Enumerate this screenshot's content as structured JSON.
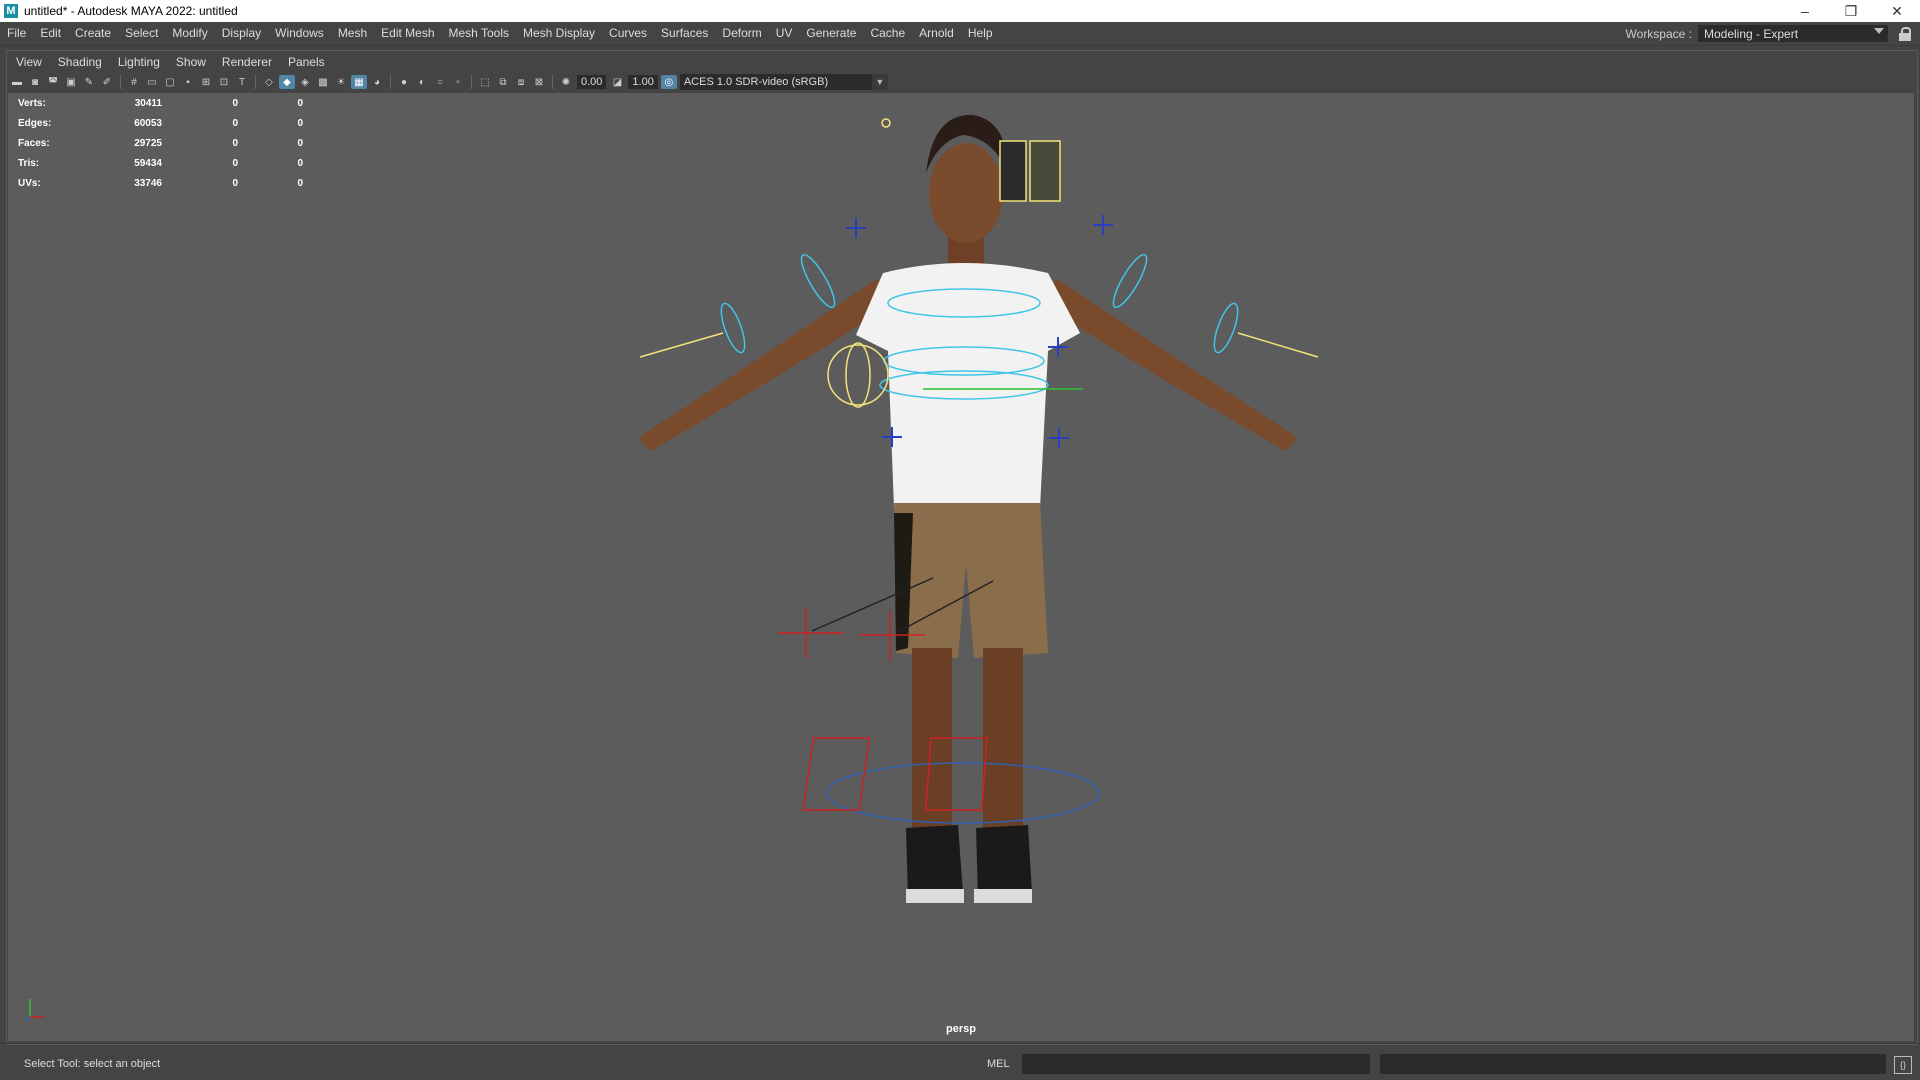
{
  "window": {
    "title": "untitled* - Autodesk MAYA 2022: untitled",
    "app_icon_letter": "M",
    "controls": {
      "minimize": "–",
      "restore": "❐",
      "close": "✕"
    }
  },
  "main_menu": [
    "File",
    "Edit",
    "Create",
    "Select",
    "Modify",
    "Display",
    "Windows",
    "Mesh",
    "Edit Mesh",
    "Mesh Tools",
    "Mesh Display",
    "Curves",
    "Surfaces",
    "Deform",
    "UV",
    "Generate",
    "Cache",
    "Arnold",
    "Help"
  ],
  "workspace": {
    "label": "Workspace :",
    "value": "Modeling - Expert"
  },
  "panel_menu": [
    "View",
    "Shading",
    "Lighting",
    "Show",
    "Renderer",
    "Panels"
  ],
  "panel_toolbar": {
    "exposure": "0.00",
    "gamma": "1.00",
    "color_space": "ACES 1.0 SDR-video (sRGB)"
  },
  "heads_up": {
    "rows": [
      {
        "label": "Verts:",
        "total": "30411",
        "selected": "0",
        "component": "0"
      },
      {
        "label": "Edges:",
        "total": "60053",
        "selected": "0",
        "component": "0"
      },
      {
        "label": "Faces:",
        "total": "29725",
        "selected": "0",
        "component": "0"
      },
      {
        "label": "Tris:",
        "total": "59434",
        "selected": "0",
        "component": "0"
      },
      {
        "label": "UVs:",
        "total": "33746",
        "selected": "0",
        "component": "0"
      }
    ]
  },
  "viewport": {
    "camera": "persp",
    "background_color": "#5c5c5c"
  },
  "help_line": "Select Tool: select an object",
  "command_line": {
    "language": "MEL"
  },
  "colors": {
    "active_tool": "#5285a6",
    "rig_control": "#3fc6e6",
    "selected_joint": "#f2e37a"
  }
}
